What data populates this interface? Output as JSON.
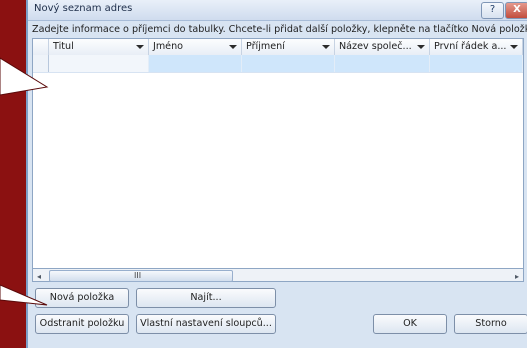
{
  "dialog": {
    "title": "Nový seznam adres",
    "help_glyph": "?",
    "close_glyph": "X",
    "instruction": "Zadejte informace o příjemci do tabulky. Chcete-li přidat další položky, klepněte na tlačítko Nová položka."
  },
  "table": {
    "columns": [
      "Titul",
      "Jméno",
      "Příjmení",
      "Název společ...",
      "První řádek a..."
    ],
    "rows": [
      [
        "",
        "",
        "",
        "",
        ""
      ]
    ]
  },
  "scrollbar": {
    "left_glyph": "◂",
    "right_glyph": "▸",
    "grip_glyph": "III"
  },
  "buttons": {
    "new_item": "Nová položka",
    "find": "Najít...",
    "delete_item": "Odstranit položku",
    "customize_columns": "Vlastní nastavení sloupců...",
    "ok": "OK",
    "cancel": "Storno"
  }
}
